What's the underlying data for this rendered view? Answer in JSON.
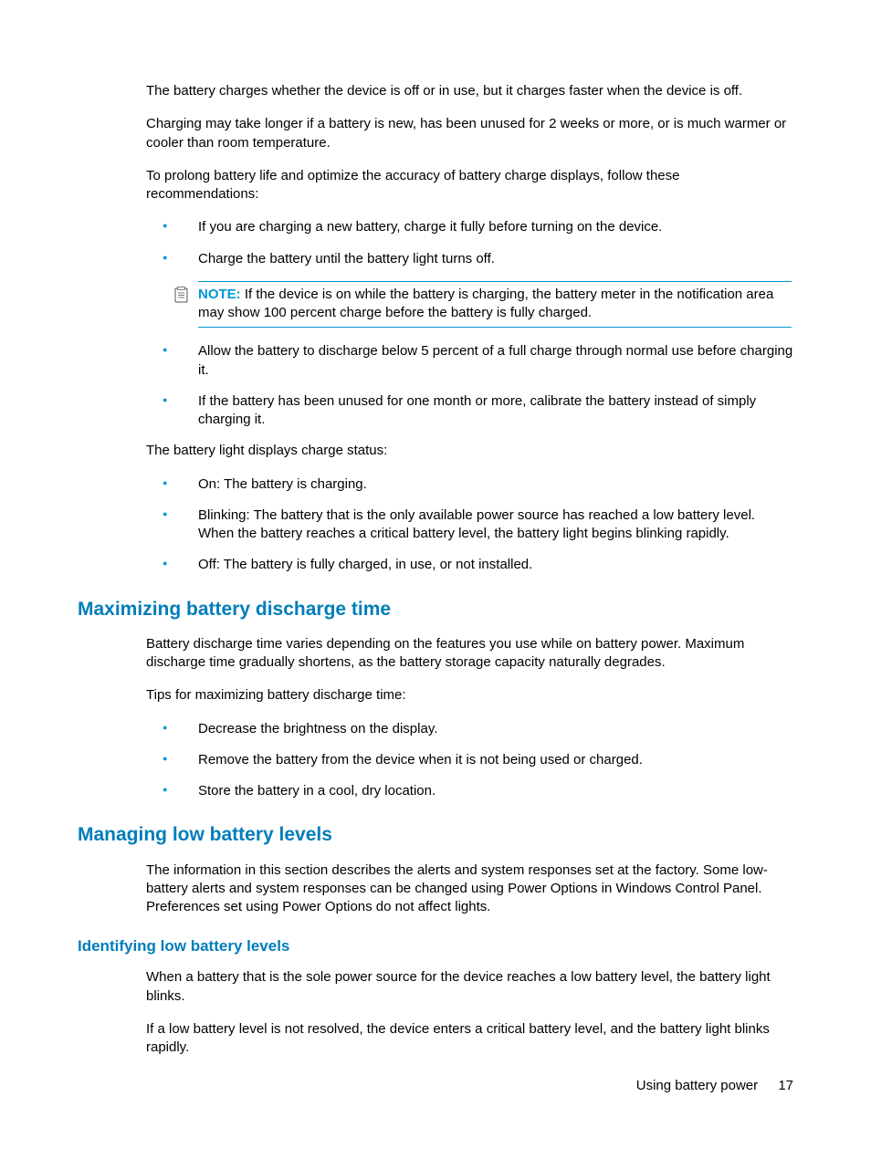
{
  "intro": {
    "p1": "The battery charges whether the device is off or in use, but it charges faster when the device is off.",
    "p2": "Charging may take longer if a battery is new, has been unused for 2 weeks or more, or is much warmer or cooler than room temperature.",
    "p3": "To prolong battery life and optimize the accuracy of battery charge displays, follow these recommendations:"
  },
  "bullets1": {
    "b1": "If you are charging a new battery, charge it fully before turning on the device.",
    "b2": "Charge the battery until the battery light turns off."
  },
  "note": {
    "label": "NOTE:",
    "text": "If the device is on while the battery is charging, the battery meter in the notification area may show 100 percent charge before the battery is fully charged."
  },
  "bullets2": {
    "b1": "Allow the battery to discharge below 5 percent of a full charge through normal use before charging it.",
    "b2": "If the battery has been unused for one month or more, calibrate the battery instead of simply charging it."
  },
  "status_intro": "The battery light displays charge status:",
  "status_bullets": {
    "b1": "On: The battery is charging.",
    "b2": "Blinking: The battery that is the only available power source has reached a low battery level. When the battery reaches a critical battery level, the battery light begins blinking rapidly.",
    "b3": "Off: The battery is fully charged, in use, or not installed."
  },
  "section_max": {
    "heading": "Maximizing battery discharge time",
    "p1": "Battery discharge time varies depending on the features you use while on battery power. Maximum discharge time gradually shortens, as the battery storage capacity naturally degrades.",
    "p2": "Tips for maximizing battery discharge time:",
    "bullets": {
      "b1": "Decrease the brightness on the display.",
      "b2": "Remove the battery from the device when it is not being used or charged.",
      "b3": "Store the battery in a cool, dry location."
    }
  },
  "section_low": {
    "heading": "Managing low battery levels",
    "p1": "The information in this section describes the alerts and system responses set at the factory. Some low-battery alerts and system responses can be changed using Power Options in Windows Control Panel. Preferences set using Power Options do not affect lights.",
    "sub_heading": "Identifying low battery levels",
    "p2": "When a battery that is the sole power source for the device reaches a low battery level, the battery light blinks.",
    "p3": "If a low battery level is not resolved, the device enters a critical battery level, and the battery light blinks rapidly."
  },
  "footer": {
    "title": "Using battery power",
    "page": "17"
  }
}
